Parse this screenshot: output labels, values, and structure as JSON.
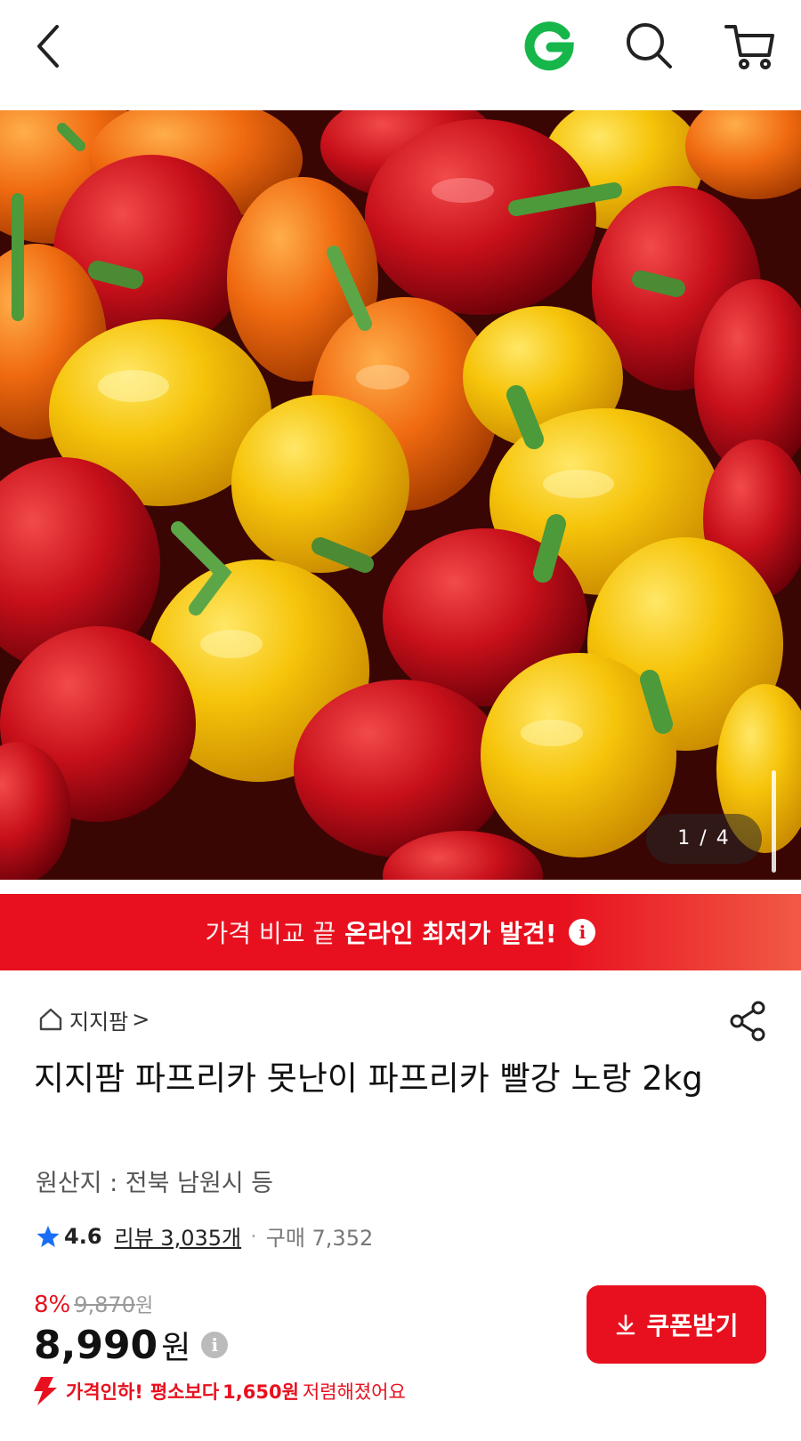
{
  "header": {
    "back_icon": "chevron-left-icon",
    "logo_icon": "g-logo-icon",
    "search_icon": "search-icon",
    "cart_icon": "cart-icon",
    "logo_color": "#16b64b"
  },
  "gallery": {
    "image_alt": "",
    "counter": "1 / 4"
  },
  "promo": {
    "light_text": "가격 비교 끝",
    "bold_text": "온라인 최저가 발견!",
    "info_icon": "i",
    "color": "#e8101e"
  },
  "product": {
    "store_name": "지지팜",
    "store_arrow": ">",
    "title": "지지팜 파프리카 못난이 파프리카 빨강 노랑 2kg",
    "origin": "원산지 : 전북 남원시 등",
    "rating": "4.6",
    "review_text": "리뷰 3,035개",
    "purchase_text": "구매 7,352",
    "discount_rate": "8%",
    "original_price": "9,870",
    "original_unit": "원",
    "price": "8,990",
    "price_unit": "원",
    "price_info_icon": "i",
    "coupon_label": "쿠폰받기",
    "price_drop": {
      "prefix": "가격인하!",
      "middle": "평소보다",
      "amount": "1,650원",
      "suffix": "저렴해졌어요"
    }
  },
  "colors": {
    "accent": "#e8101e",
    "star": "#1a6ef5"
  }
}
